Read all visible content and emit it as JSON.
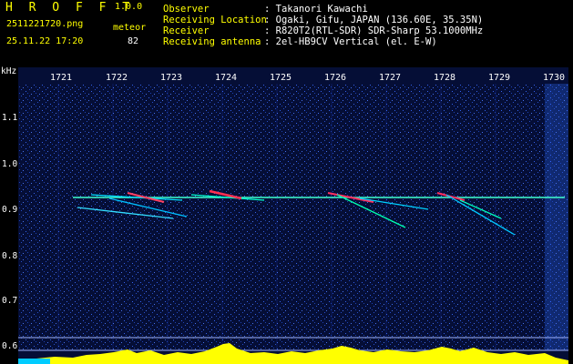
{
  "header": {
    "logo": "H R O F F T",
    "version": "1.0.0",
    "filename": "2511221720.png",
    "meteor_label": "meteor",
    "datetime": "25.11.22 17:20",
    "meteor_count": "82",
    "info": [
      {
        "key": "Observer",
        "value": ": Takanori Kawachi"
      },
      {
        "key": "Receiving Location",
        "value": ": Ogaki, Gifu, JAPAN (136.60E, 35.35N)"
      },
      {
        "key": "Receiver",
        "value": ": R820T2(RTL-SDR) SDR-Sharp 53.1000MHz"
      },
      {
        "key": "Receiving antenna",
        "value": ": 2el-HB9CV Vertical (el. E-W)"
      }
    ]
  },
  "axes": {
    "y_unit": "kHz",
    "y_ticks": [
      "1.1",
      "1.0",
      "0.9",
      "0.8",
      "0.7",
      "0.6"
    ],
    "x_ticks": [
      "1721",
      "1722",
      "1723",
      "1724",
      "1725",
      "1726",
      "1727",
      "1728",
      "1729",
      "1730"
    ]
  },
  "colors": {
    "background": "#000000",
    "header_text": "#00ffff",
    "logo_text": "#ffff00",
    "plot_bg": "#050e36",
    "carrier": "#40ffd0",
    "bottom_spectrum": "#ffff00"
  }
}
